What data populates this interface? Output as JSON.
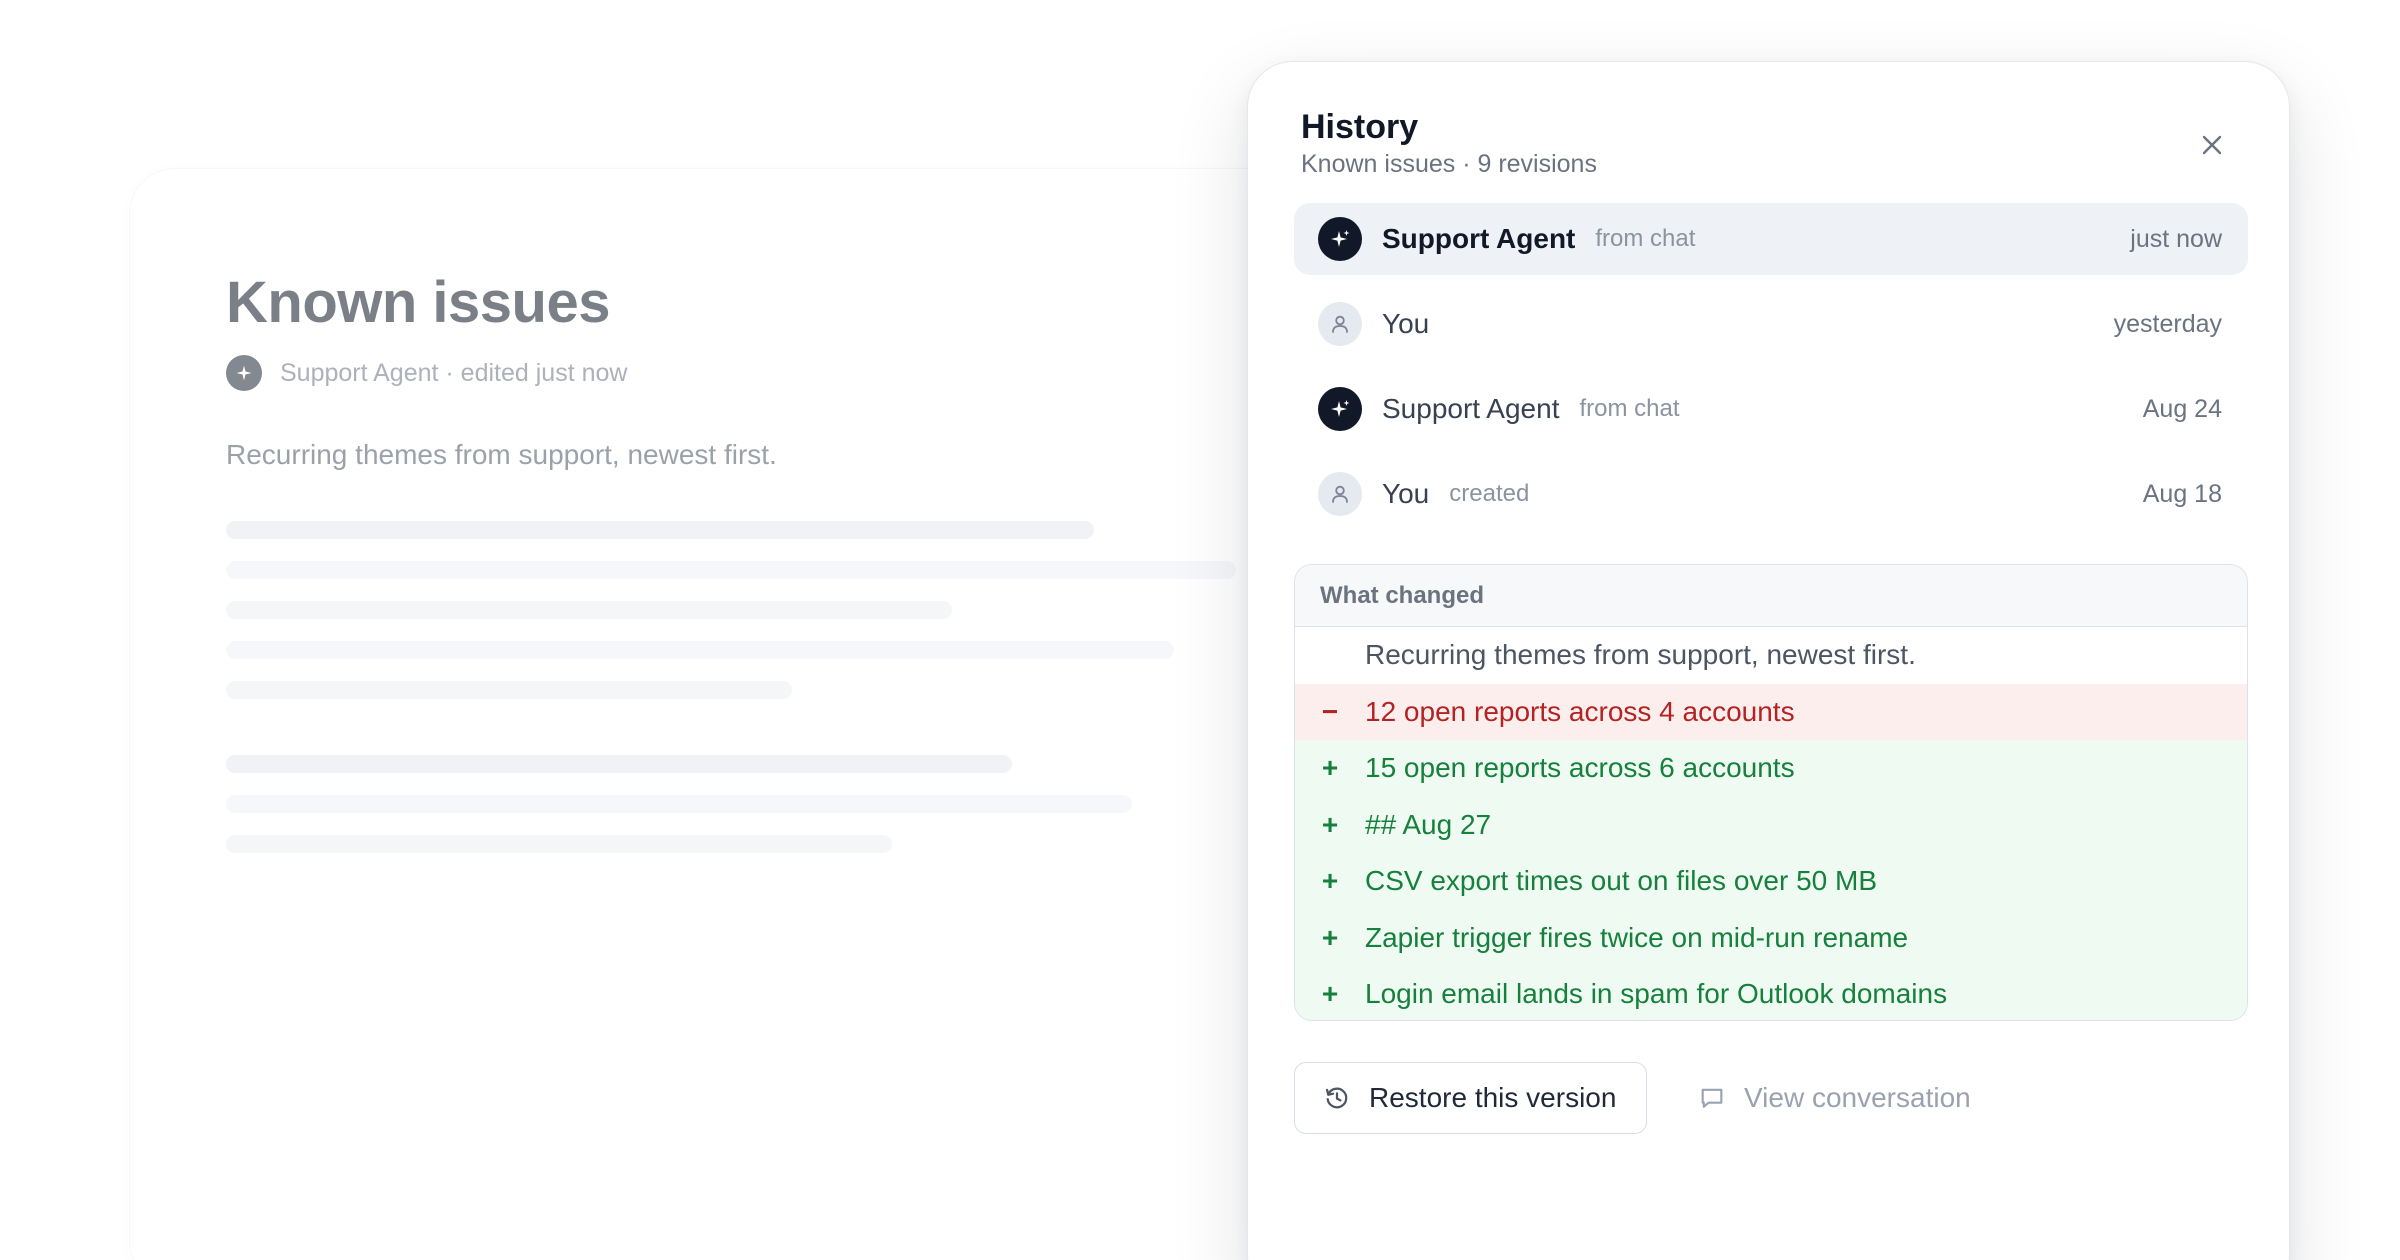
{
  "document": {
    "title": "Known issues",
    "meta": "Support Agent · edited just now",
    "subtitle": "Recurring themes from support, newest first."
  },
  "history": {
    "title": "History",
    "subtitle": "Known issues · 9 revisions",
    "revisions": [
      {
        "author": "Support Agent",
        "note": "from chat",
        "time": "just now",
        "kind": "agent",
        "selected": true
      },
      {
        "author": "You",
        "note": "",
        "time": "yesterday",
        "kind": "user",
        "selected": false
      },
      {
        "author": "Support Agent",
        "note": "from chat",
        "time": "Aug 24",
        "kind": "agent",
        "selected": false
      },
      {
        "author": "You",
        "note": "created",
        "time": "Aug 18",
        "kind": "user",
        "selected": false
      }
    ],
    "diff": {
      "heading": "What changed",
      "lines": [
        {
          "type": "ctx",
          "sign": "",
          "text": "Recurring themes from support, newest first."
        },
        {
          "type": "del",
          "sign": "−",
          "text": "12 open reports across 4 accounts"
        },
        {
          "type": "add",
          "sign": "+",
          "text": "15 open reports across 6 accounts"
        },
        {
          "type": "add",
          "sign": "+",
          "text": "## Aug 27"
        },
        {
          "type": "add",
          "sign": "+",
          "text": "CSV export times out on files over 50 MB"
        },
        {
          "type": "add",
          "sign": "+",
          "text": "Zapier trigger fires twice on mid-run rename"
        },
        {
          "type": "add",
          "sign": "+",
          "text": "Login email lands in spam for Outlook domains"
        }
      ]
    },
    "actions": {
      "restore_label": "Restore this version",
      "view_label": "View conversation"
    }
  },
  "colors": {
    "agent_avatar": "#111827",
    "user_avatar": "#e5e9f0",
    "selected_row": "#eef1f6",
    "deleted_bg": "#fdeeee",
    "deleted_text": "#b42323",
    "added_bg": "#effbf2",
    "added_text": "#16803c"
  },
  "icons": {
    "agent": "sparkle-icon",
    "user": "person-icon",
    "close": "close-icon",
    "restore": "history-icon",
    "view": "chat-bubble-icon"
  }
}
